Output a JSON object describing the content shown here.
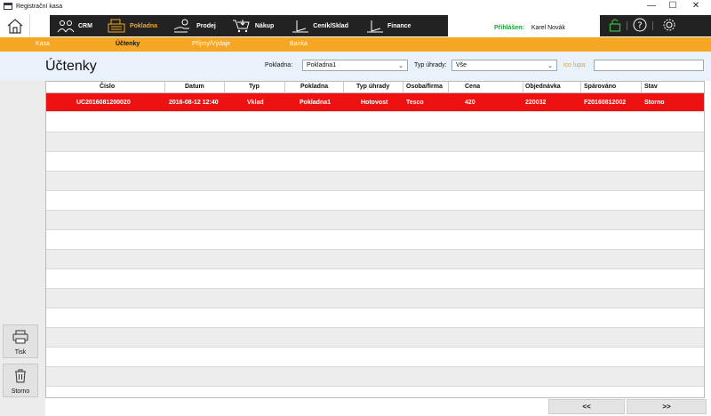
{
  "window": {
    "title": "Registrační kasa",
    "minimize": "—",
    "maximize": "☐",
    "close": "✕"
  },
  "nav": {
    "items": [
      {
        "label": "CRM",
        "icon": "people-icon"
      },
      {
        "label": "Pokladna",
        "icon": "cash-register-icon",
        "active": true
      },
      {
        "label": "Prodej",
        "icon": "hand-coins-icon"
      },
      {
        "label": "Nákup",
        "icon": "cart-icon"
      },
      {
        "label": "Ceník/Sklad",
        "icon": "scale-icon"
      },
      {
        "label": "Finance",
        "icon": "scale-icon"
      }
    ],
    "accent": "#f5a623"
  },
  "user": {
    "label": "Přihlášen:",
    "name": "Karel Novák"
  },
  "subnav": {
    "items": [
      "Kasa",
      "Účtenky",
      "Příjmy/Výdaje",
      "Banka"
    ],
    "active": "Účtenky"
  },
  "filters": {
    "title": "Účtenky",
    "pokladna_label": "Pokladna:",
    "pokladna_value": "Pokladna1",
    "typ_label": "Typ úhrady:",
    "typ_value": "Vše",
    "ico_label": "ico lupa:",
    "ico_value": ""
  },
  "table": {
    "columns": [
      "Číslo",
      "Datum",
      "Typ",
      "Pokladna",
      "Typ úhrady",
      "Osoba/firma",
      "Cena",
      "Objednávka",
      "Spárováno",
      "Stav"
    ],
    "rows": [
      [
        "UC2016081200020",
        "2016-08-12 12:40",
        "Vklad",
        "Pokladna1",
        "Hotovost",
        "Tesco",
        "420",
        "220032",
        "F20160812002",
        "Storno"
      ]
    ],
    "selected_color": "#ee1111"
  },
  "sidebar": {
    "print_label": "Tisk",
    "storno_label": "Storno"
  },
  "pager": {
    "prev": "<<",
    "next": ">>"
  }
}
